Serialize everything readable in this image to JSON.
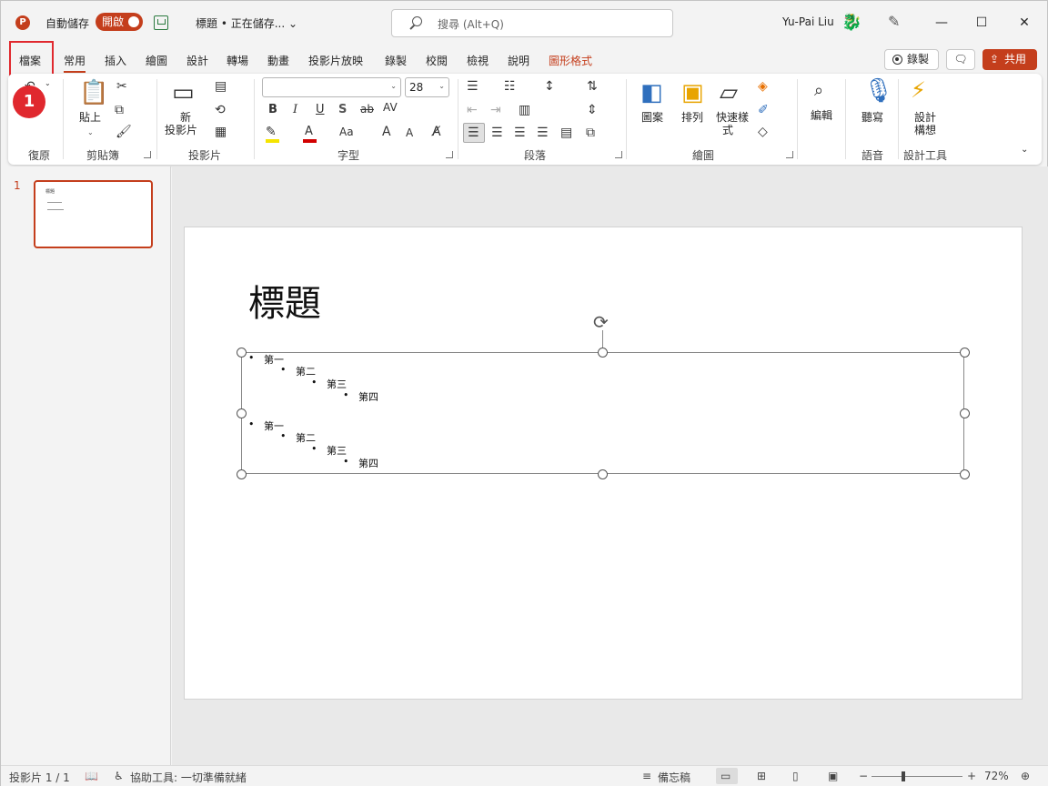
{
  "titlebar": {
    "autosave_label": "自動儲存",
    "autosave_state": "開啟",
    "doc_title": "標題 • 正在儲存... ⌄",
    "search_placeholder": "搜尋 (Alt+Q)",
    "user_name": "Yu-Pai Liu",
    "minimize": "—",
    "maximize": "☐",
    "close": "✕"
  },
  "tabs": [
    "檔案",
    "常用",
    "插入",
    "繪圖",
    "設計",
    "轉場",
    "動畫",
    "投影片放映",
    "錄製",
    "校閱",
    "檢視",
    "說明",
    "圖形格式"
  ],
  "active_tab": "常用",
  "highlighted_tab": "檔案",
  "step_badge": "1",
  "right_buttons": {
    "record": "錄製",
    "share": "共用"
  },
  "ribbon": {
    "groups": [
      "復原",
      "剪貼簿",
      "投影片",
      "字型",
      "段落",
      "繪圖",
      "語音",
      "設計工具"
    ],
    "paste": "貼上",
    "new_slide_line1": "新",
    "new_slide_line2": "投影片",
    "font_name": "",
    "font_size": "28",
    "shapes": "圖案",
    "arrange": "排列",
    "quick_styles_line1": "快速樣",
    "quick_styles_line2": "式",
    "editing": "編輯",
    "dictate": "聽寫",
    "designer_line1": "設計",
    "designer_line2": "構想",
    "bold": "B",
    "italic": "I",
    "underline": "U",
    "shadow": "S",
    "strike": "ab",
    "spacing": "AV",
    "font_color": "A",
    "change_case": "Aa",
    "grow": "A",
    "shrink": "A"
  },
  "colors": {
    "accent": "#c43e1c",
    "highlight_box": "#e0282e",
    "highlight_yellow": "#f5e400",
    "font_red": "#d20000"
  },
  "slide_panel": {
    "slide_number": "1",
    "thumb_title": "標題"
  },
  "slide": {
    "title": "標題",
    "bullets": [
      {
        "text": "第一",
        "level": 1
      },
      {
        "text": "第二",
        "level": 2
      },
      {
        "text": "第三",
        "level": 3
      },
      {
        "text": "第四",
        "level": 4
      },
      {
        "text": "第一",
        "level": 1
      },
      {
        "text": "第二",
        "level": 2
      },
      {
        "text": "第三",
        "level": 3
      },
      {
        "text": "第四",
        "level": 4
      }
    ],
    "bullet_char": "•"
  },
  "statusbar": {
    "slide_info": "投影片 1 / 1",
    "accessibility": "協助工具: 一切準備就緒",
    "notes": "備忘稿",
    "zoom_minus": "−",
    "zoom_plus": "+",
    "zoom_level": "72%"
  }
}
